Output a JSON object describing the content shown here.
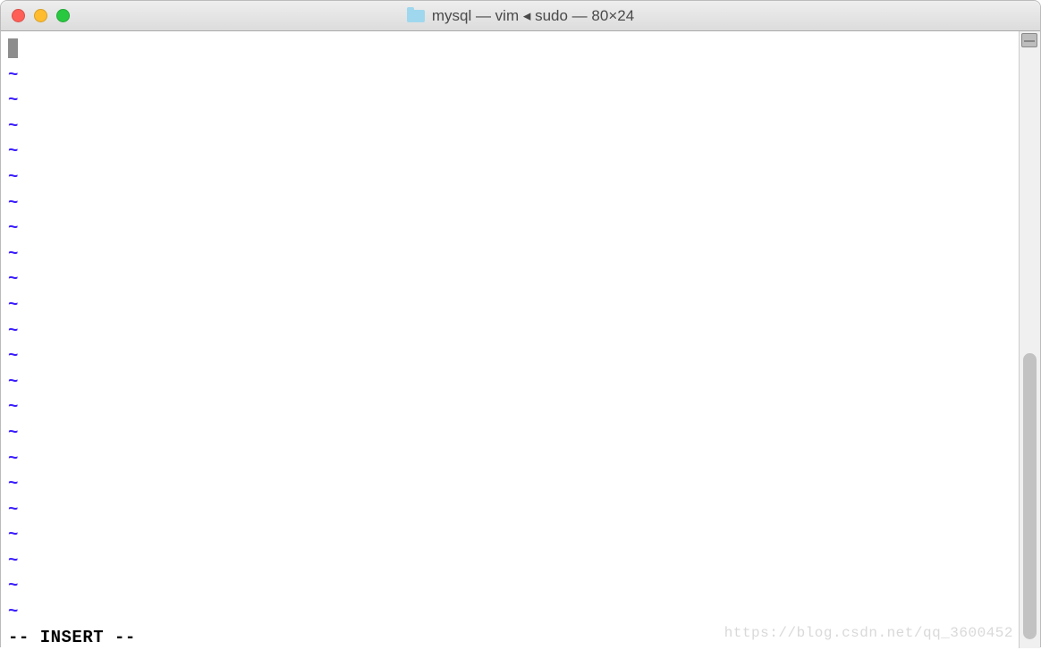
{
  "titlebar": {
    "title": "mysql — vim ◂ sudo — 80×24"
  },
  "editor": {
    "tilde": "~",
    "tilde_count": 22,
    "status": "-- INSERT --"
  },
  "watermark": "https://blog.csdn.net/qq_3600452"
}
